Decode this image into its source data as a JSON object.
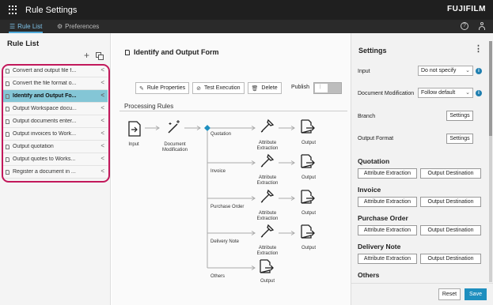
{
  "app": {
    "title": "Rule Settings",
    "brand": "FUJIFILM"
  },
  "tabs": {
    "rule_list": "Rule List",
    "preferences": "Preferences"
  },
  "left": {
    "title": "Rule List",
    "items": [
      {
        "label": "Convert and output file f..."
      },
      {
        "label": "Convert the file format o..."
      },
      {
        "label": "Identify and Output Fo..."
      },
      {
        "label": "Output Workspace docu..."
      },
      {
        "label": "Output documents enter..."
      },
      {
        "label": "Output invoices to Work..."
      },
      {
        "label": "Output quotation"
      },
      {
        "label": "Output quotes to Works..."
      },
      {
        "label": "Register a document in ..."
      }
    ],
    "selected_index": 2,
    "highlight_color": "#c2185b"
  },
  "center": {
    "title": "Identify and Output Form",
    "toolbar": {
      "rule_properties": "Rule Properties",
      "test_execution": "Test Execution",
      "delete": "Delete",
      "publish": "Publish"
    },
    "processing_rules": "Processing Rules",
    "flow": {
      "input": "Input",
      "document_modification": "Document\nModification",
      "branches": [
        {
          "label": "Quotation",
          "step": "Attribute\nExtraction",
          "output": "Output"
        },
        {
          "label": "Invoice",
          "step": "Attribute\nExtraction",
          "output": "Output"
        },
        {
          "label": "Purchase Order",
          "step": "Attribute\nExtraction",
          "output": "Output"
        },
        {
          "label": "Delivery Note",
          "step": "Attribute\nExtraction",
          "output": "Output"
        },
        {
          "label": "Others",
          "output": "Output"
        }
      ],
      "accent_color": "#1f8fbf"
    }
  },
  "settings": {
    "title": "Settings",
    "input_label": "Input",
    "input_value": "Do not specify",
    "doc_mod_label": "Document Modification",
    "doc_mod_value": "Follow default",
    "branch_label": "Branch",
    "output_format_label": "Output Format",
    "settings_button": "Settings",
    "sections": [
      {
        "title": "Quotation",
        "attr": "Attribute Extraction",
        "dest": "Output Destination"
      },
      {
        "title": "Invoice",
        "attr": "Attribute Extraction",
        "dest": "Output Destination"
      },
      {
        "title": "Purchase Order",
        "attr": "Attribute Extraction",
        "dest": "Output Destination"
      },
      {
        "title": "Delivery Note",
        "attr": "Attribute Extraction",
        "dest": "Output Destination"
      },
      {
        "title": "Others"
      }
    ],
    "reset": "Reset",
    "save": "Save"
  }
}
